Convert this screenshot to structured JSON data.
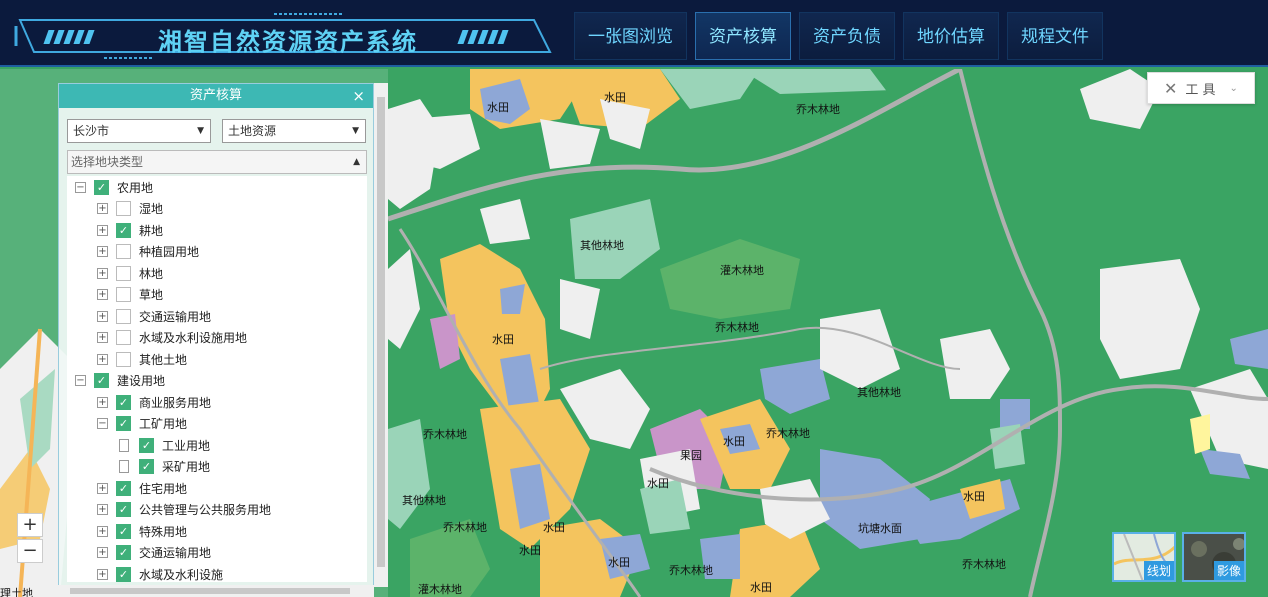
{
  "header": {
    "title": "湘智自然资源资产系统",
    "nav": [
      "一张图浏览",
      "资产核算",
      "资产负债",
      "地价估算",
      "规程文件"
    ],
    "active_nav": "资产核算"
  },
  "tools": {
    "label": "工 具",
    "icon": "tools-icon",
    "chevron": "⌄"
  },
  "zoom": {
    "in": "+",
    "out": "−"
  },
  "basemaps": [
    {
      "label": "线划"
    },
    {
      "label": "影像"
    }
  ],
  "panel": {
    "title": "资产核算",
    "close": "×",
    "city_select": "长沙市",
    "resource_select": "土地资源",
    "type_placeholder": "选择地块类型",
    "tree": [
      {
        "label": "农用地",
        "level": 0,
        "expander": "−",
        "checked": true
      },
      {
        "label": "湿地",
        "level": 1,
        "expander": "+",
        "checked": false
      },
      {
        "label": "耕地",
        "level": 1,
        "expander": "+",
        "checked": true
      },
      {
        "label": "种植园用地",
        "level": 1,
        "expander": "+",
        "checked": false
      },
      {
        "label": "林地",
        "level": 1,
        "expander": "+",
        "checked": false
      },
      {
        "label": "草地",
        "level": 1,
        "expander": "+",
        "checked": false
      },
      {
        "label": "交通运输用地",
        "level": 1,
        "expander": "+",
        "checked": false
      },
      {
        "label": "水域及水利设施用地",
        "level": 1,
        "expander": "+",
        "checked": false
      },
      {
        "label": "其他土地",
        "level": 1,
        "expander": "+",
        "checked": false
      },
      {
        "label": "建设用地",
        "level": 0,
        "expander": "−",
        "checked": true
      },
      {
        "label": "商业服务用地",
        "level": 1,
        "expander": "+",
        "checked": true
      },
      {
        "label": "工矿用地",
        "level": 1,
        "expander": "−",
        "checked": true
      },
      {
        "label": "工业用地",
        "level": 2,
        "expander": "",
        "checked": true
      },
      {
        "label": "采矿用地",
        "level": 2,
        "expander": "",
        "checked": true
      },
      {
        "label": "住宅用地",
        "level": 1,
        "expander": "+",
        "checked": true
      },
      {
        "label": "公共管理与公共服务用地",
        "level": 1,
        "expander": "+",
        "checked": true
      },
      {
        "label": "特殊用地",
        "level": 1,
        "expander": "+",
        "checked": true
      },
      {
        "label": "交通运输用地",
        "level": 1,
        "expander": "+",
        "checked": true
      },
      {
        "label": "水域及水利设施",
        "level": 1,
        "expander": "+",
        "checked": true
      }
    ]
  },
  "map_labels": [
    "水田",
    "水田",
    "乔木林地",
    "其他林地",
    "灌木林地",
    "乔木林地",
    "水田",
    "其他林地",
    "乔木林地",
    "乔木林地",
    "水田",
    "果园",
    "水田",
    "其他林地",
    "乔木林地",
    "水田",
    "水田",
    "水田",
    "乔木林地",
    "坑塘水面",
    "水田",
    "乔木林地",
    "灌木林地",
    "水田",
    "理土地"
  ],
  "colors": {
    "forest": "#3aa463",
    "paddy": "#f4c45e",
    "water": "#8ea7d6",
    "building": "#efefef",
    "orchard": "#c995c9",
    "grass": "#9ad4b8",
    "header": "#0b1a3d",
    "accent": "#5fd2f5",
    "panel_header": "#3db8b4",
    "check": "#3fb07a"
  }
}
